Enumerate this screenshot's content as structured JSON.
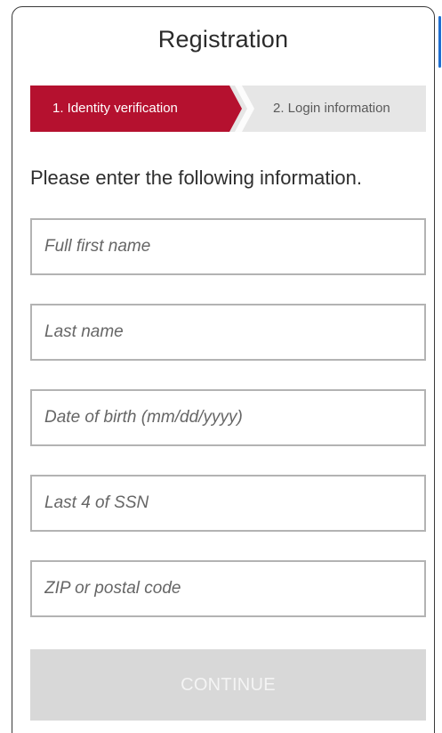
{
  "form": {
    "title": "Registration",
    "instruction": "Please enter the following information."
  },
  "stepper": {
    "steps": [
      {
        "label": "1. Identity verification",
        "active": true
      },
      {
        "label": "2. Login information",
        "active": false
      }
    ]
  },
  "fields": {
    "first_name": {
      "placeholder": "Full first name",
      "value": ""
    },
    "last_name": {
      "placeholder": "Last name",
      "value": ""
    },
    "dob": {
      "placeholder": "Date of birth (mm/dd/yyyy)",
      "value": ""
    },
    "ssn_last4": {
      "placeholder": "Last 4 of SSN",
      "value": ""
    },
    "zip": {
      "placeholder": "ZIP or postal code",
      "value": ""
    }
  },
  "actions": {
    "continue_label": "CONTINUE",
    "continue_disabled": true
  },
  "colors": {
    "accent": "#b5112f",
    "stepper_inactive": "#e6e6e6",
    "button_disabled": "#d8d8d8",
    "scrollbar": "#1f6fd1"
  }
}
